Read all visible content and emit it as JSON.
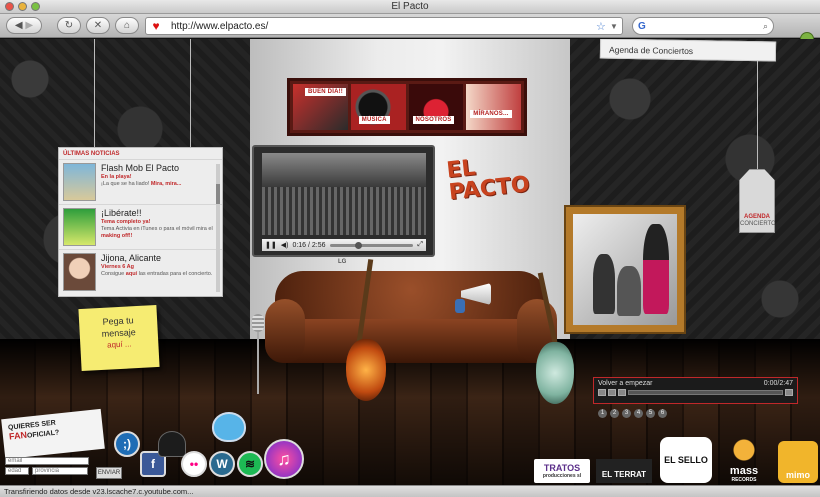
{
  "window": {
    "title": "El Pacto"
  },
  "toolbar": {
    "url": "http://www.elpacto.es/",
    "search_engine": "G",
    "search_placeholder": ""
  },
  "menu": {
    "items": [
      {
        "label": "BUEN DÍA!!"
      },
      {
        "label": "MÚSICA"
      },
      {
        "label": "NOSOTROS"
      },
      {
        "label": "MÍRANOS..."
      }
    ]
  },
  "logo": {
    "line1": "EL",
    "line2": "PACTO"
  },
  "video": {
    "time": "0:16 / 2:56",
    "brand": "LG"
  },
  "news": {
    "header": "ÚLTIMAS NOTICIAS",
    "items": [
      {
        "title": "Flash Mob El Pacto",
        "subtitle": "En la playa!",
        "body_pre": "¡La que se ha liado! ",
        "body_link": "Mira, mira...",
        "body_post": ""
      },
      {
        "title": "¡Libérate!!",
        "subtitle": "Tema completo ya!",
        "body_pre": "Tema Activia en iTunes o para el móvil mira el ",
        "body_link": "making off!!",
        "body_post": ""
      },
      {
        "title": "Jijona, Alicante",
        "subtitle": "Viernes 6 Ag",
        "body_pre": "Consigue ",
        "body_link": "aquí",
        "body_post": " las entradas para el concierto."
      }
    ]
  },
  "note": {
    "line1": "Pega tu",
    "line2": "mensaje",
    "link": "aquí ..."
  },
  "agenda": {
    "top_label": "Agenda de Conciertos",
    "tag_title": "AGENDA",
    "tag_sub": "CONCIERTOS"
  },
  "player": {
    "track": "Volver a empezar",
    "time": "0:00/2:47",
    "tracks": [
      "1",
      "2",
      "3",
      "4",
      "5",
      "6"
    ]
  },
  "fan": {
    "line1": "QUIERES SER",
    "line2_prefix": "FAN",
    "line2_suffix": "OFICIAL?",
    "email_placeholder": "email",
    "age_placeholder": "edad",
    "province_placeholder": "provincia",
    "submit_label": "ENVIAR"
  },
  "social": [
    {
      "name": "tuenti",
      "label": ";)"
    },
    {
      "name": "facebook",
      "label": "f"
    },
    {
      "name": "flickr",
      "label": "••"
    },
    {
      "name": "wordpress",
      "label": "W"
    },
    {
      "name": "spotify",
      "label": "≋"
    },
    {
      "name": "itunes",
      "label": "♫"
    }
  ],
  "brands": [
    {
      "name": "tratos",
      "label": "TRATOS",
      "sub": "producciones sl"
    },
    {
      "name": "elterrat",
      "label": "EL TERRAT"
    },
    {
      "name": "elsello",
      "label": "EL SELLO"
    },
    {
      "name": "mass",
      "label": "mass",
      "sub": "RECORDS"
    },
    {
      "name": "mimo",
      "label": "mimo"
    }
  ],
  "statusbar": {
    "text": "Transfiriendo datos desde v23.lscache7.c.youtube.com..."
  },
  "colors": {
    "accent": "#c0282a",
    "logo": "#c8431f"
  }
}
